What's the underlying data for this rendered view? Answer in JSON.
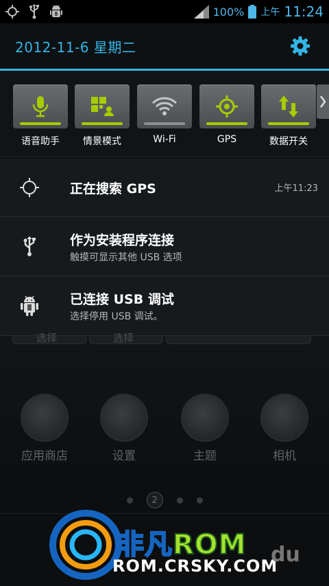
{
  "status_bar": {
    "icons_left": [
      "gps-searching-icon",
      "usb-icon",
      "android-debug-icon"
    ],
    "signal_icon": "signal-icon",
    "battery_percent": "100%",
    "battery_icon": "battery-full-icon",
    "ampm": "上午",
    "time": "11:24"
  },
  "header": {
    "date": "2012-11-6 星期二",
    "settings_icon": "gear-icon"
  },
  "toggles": [
    {
      "label": "语音助手",
      "icon": "microphone-icon",
      "state": "on"
    },
    {
      "label": "情景模式",
      "icon": "scene-mode-icon",
      "state": "on"
    },
    {
      "label": "Wi-Fi",
      "icon": "wifi-icon",
      "state": "off"
    },
    {
      "label": "GPS",
      "icon": "gps-icon",
      "state": "on"
    },
    {
      "label": "数据开关",
      "icon": "data-toggle-icon",
      "state": "on"
    }
  ],
  "notifications": [
    {
      "title": "正在搜索 GPS",
      "subtitle": "",
      "time": "上午11:23",
      "icon": "gps-searching-icon"
    },
    {
      "title": "作为安装程序连接",
      "subtitle": "触摸可显示其他 USB 选项",
      "time": "",
      "icon": "usb-icon"
    },
    {
      "title": "已连接 USB 调试",
      "subtitle": "选择停用 USB 调试。",
      "time": "",
      "icon": "android-debug-icon"
    }
  ],
  "home": {
    "widget_buttons": [
      "选择",
      "选择"
    ],
    "apps": [
      {
        "label": "应用商店"
      },
      {
        "label": "设置"
      },
      {
        "label": "主题"
      },
      {
        "label": "相机"
      }
    ],
    "page_indicator": "2"
  },
  "watermark": {
    "brand_part1": "非凡",
    "brand_part2": "ROM",
    "url": "ROM.CRSKY.COM",
    "du": "du"
  },
  "colors": {
    "accent": "#33b5e5",
    "toggle_on": "#a6cc00"
  }
}
